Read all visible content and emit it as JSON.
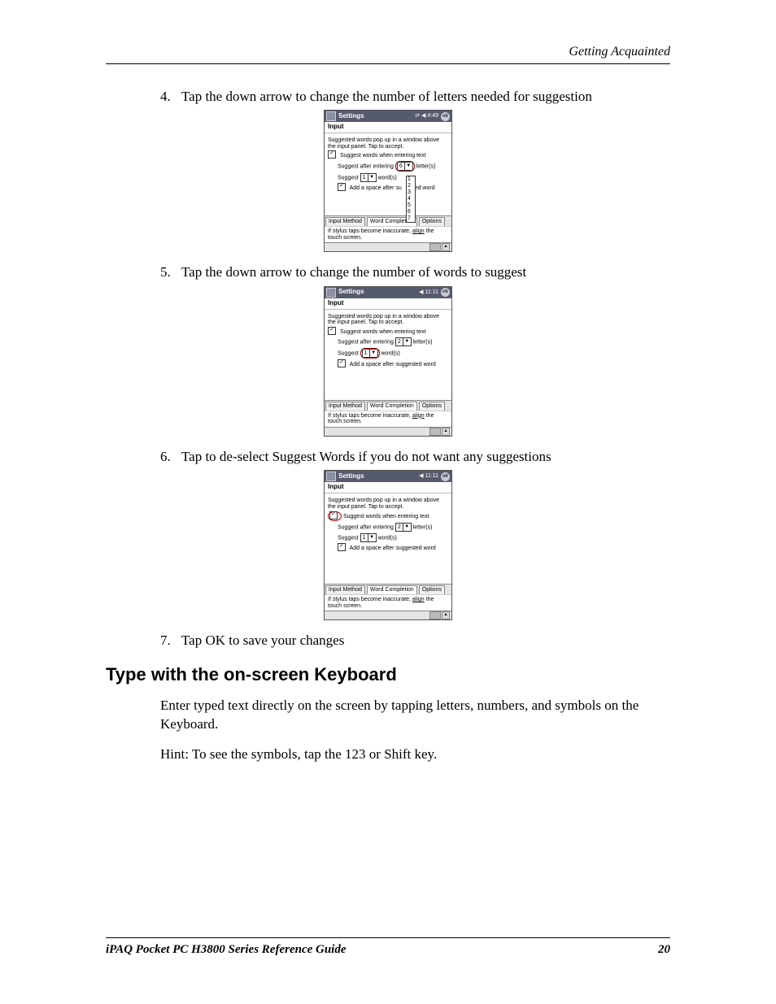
{
  "header": {
    "running": "Getting Acquainted"
  },
  "steps": {
    "s4": {
      "num": "4.",
      "text": "Tap the down arrow to change the number of letters needed for suggestion"
    },
    "s5": {
      "num": "5.",
      "text": "Tap the down arrow to change the number of words to suggest"
    },
    "s6": {
      "num": "6.",
      "text": "Tap to de-select Suggest Words if you do not want any suggestions"
    },
    "s7": {
      "num": "7.",
      "text": "Tap OK to save your changes"
    }
  },
  "section": {
    "h2": "Type with the on-screen Keyboard"
  },
  "para": {
    "p1": "Enter typed text directly on the screen by tapping letters, numbers, and symbols on the Keyboard.",
    "p2": "Hint: To see the symbols, tap the 123 or Shift key."
  },
  "footer": {
    "guide": "iPAQ Pocket PC H3800 Series Reference Guide",
    "page": "20"
  },
  "ppc_common": {
    "title": "Settings",
    "ok": "ok",
    "subtitle": "Input",
    "desc": "Suggested words pop up in a window above the input panel.  Tap to accept.",
    "suggest_words": "Suggest words when entering text",
    "suggest_after_pre": "Suggest after entering",
    "suggest_after_post": "letter(s)",
    "suggest_pre": "Suggest",
    "suggest_post": "word(s)",
    "add_space": "Add a space after suggested word",
    "add_space_trunc_pre": "Add a space after su",
    "add_space_trunc_post": "ed word",
    "tabs": {
      "t1": "Input Method",
      "t2": "Word Completion",
      "t3": "Options"
    },
    "align_pre": "If stylus taps become inaccurate, ",
    "align_link": "align",
    "align_post": " the touch screen."
  },
  "shot1": {
    "clock": "4:49",
    "letters_val": "6",
    "words_val": "1",
    "drop": [
      "1",
      "2",
      "3",
      "4",
      "5",
      "6",
      "7"
    ]
  },
  "shot2": {
    "clock": "11:11",
    "letters_val": "2",
    "words_val": "1"
  },
  "shot3": {
    "clock": "11:11",
    "letters_val": "2",
    "words_val": "1"
  }
}
